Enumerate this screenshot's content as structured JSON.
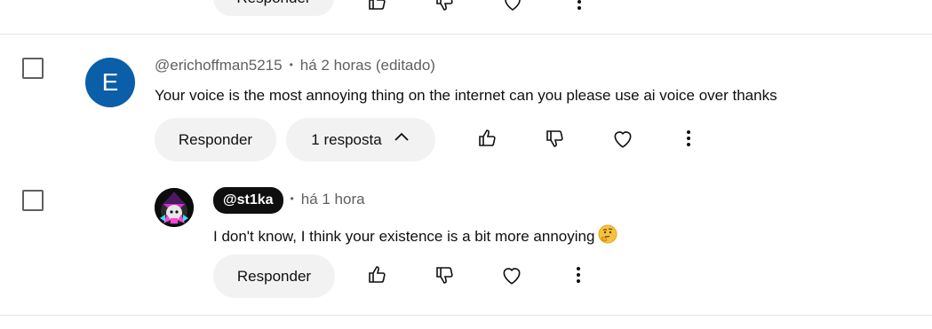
{
  "top_partial": {
    "reply_label": "Responder"
  },
  "comments": [
    {
      "avatar_letter": "E",
      "author": "@erichoffman5215",
      "time": "há 2 horas (editado)",
      "text": "Your voice is the most annoying thing on the internet can you please use ai voice over thanks",
      "reply_label": "Responder",
      "replies_label": "1 resposta"
    },
    {
      "author": "@st1ka",
      "time": "há 1 hora",
      "text": "I don't know, I think your existence is a bit more annoying",
      "emoji": "thinking-face",
      "reply_label": "Responder"
    }
  ],
  "separator": "•",
  "icons": [
    "like-icon",
    "dislike-icon",
    "heart-icon",
    "more-icon",
    "chevron-up-icon",
    "thinking-face-emoji"
  ],
  "colors": {
    "avatar_e": "#0b5ea8",
    "button_bg": "#f2f2f2",
    "meta_text": "#606060",
    "handle_pill": "#0f0f0f"
  }
}
